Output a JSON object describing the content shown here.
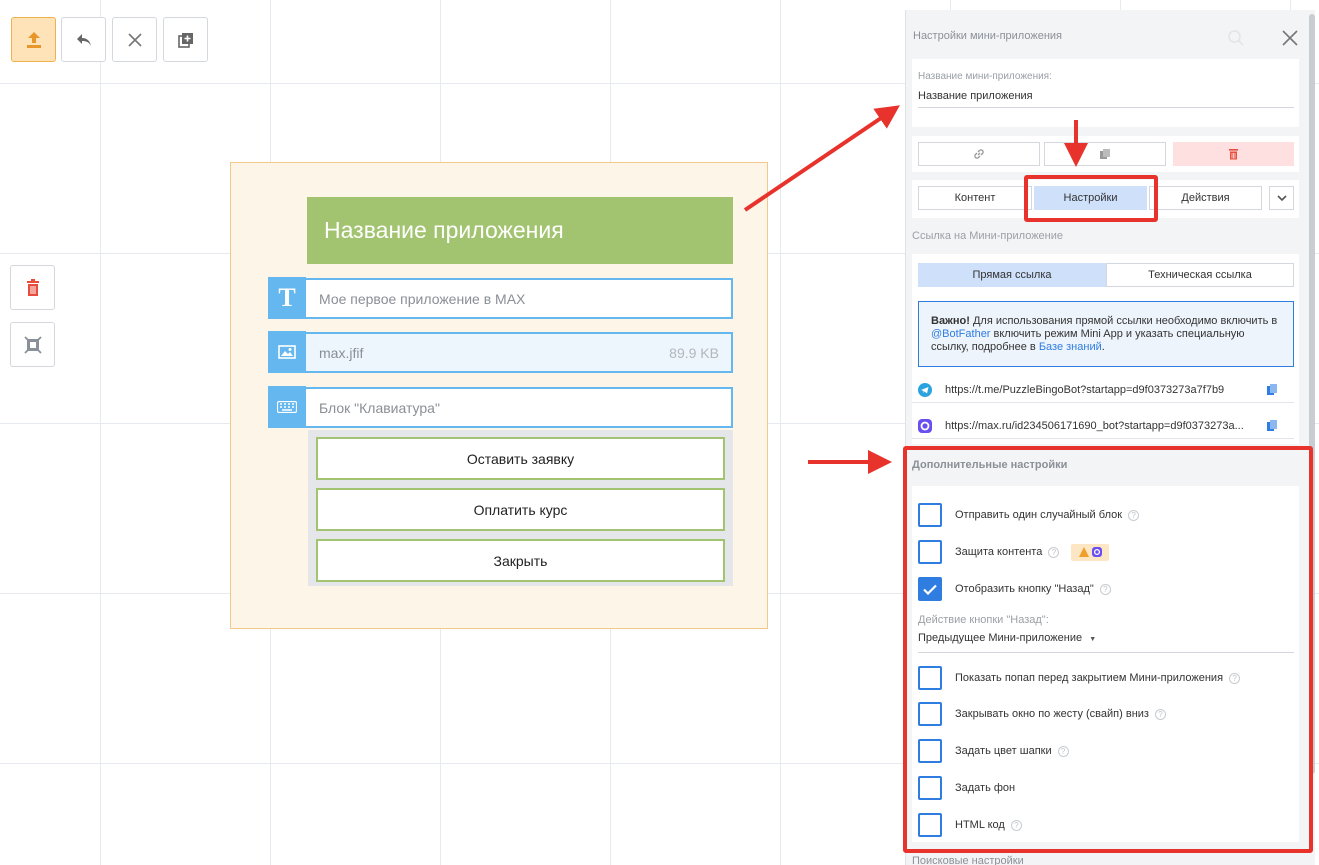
{
  "toolbar": {
    "upload_icon": "upload-icon",
    "undo_icon": "undo-icon",
    "close_icon": "close-icon",
    "add_icon": "add-copy-icon"
  },
  "side_tools": {
    "delete_icon": "trash-icon",
    "fit_icon": "fit-frame-icon"
  },
  "app_preview": {
    "title": "Название приложения",
    "text_block": "Мое первое приложение в MAX",
    "image_block": "max.jfif",
    "image_size": "89.9 KB",
    "keyboard_block": "Блок \"Клавиатура\"",
    "buttons": [
      "Оставить заявку",
      "Оплатить курс",
      "Закрыть"
    ]
  },
  "panel": {
    "title": "Настройки мини-приложения",
    "name_label": "Название мини-приложения:",
    "name_value": "Название приложения",
    "tabs": [
      "Контент",
      "Настройки",
      "Действия"
    ],
    "active_tab": "Настройки",
    "link_section_title": "Ссылка на Мини-приложение",
    "link_tabs": [
      "Прямая ссылка",
      "Техническая ссылка"
    ],
    "notice_bold": "Важно!",
    "notice_text_1": " Для использования прямой ссылки необходимо включить в ",
    "notice_link_1": "@BotFather",
    "notice_text_2": " включить режим Mini App и указать специальную ссылку, подробнее в ",
    "notice_link_2": "Базе знаний",
    "notice_text_3": ".",
    "link_telegram": "https://t.me/PuzzleBingoBot?startapp=d9f0373273a7f7b9",
    "link_max": "https://max.ru/id234506171690_bot?startapp=d9f0373273a...",
    "extra_title": "Дополнительные настройки",
    "options": [
      {
        "label": "Отправить один случайный блок",
        "checked": false
      },
      {
        "label": "Защита контента",
        "checked": false
      },
      {
        "label": "Отобразить кнопку \"Назад\"",
        "checked": true
      },
      {
        "label": "Показать попап перед закрытием Мини-приложения",
        "checked": false
      },
      {
        "label": "Закрывать окно по жесту (свайп) вниз",
        "checked": false
      },
      {
        "label": "Задать цвет шапки",
        "checked": false
      },
      {
        "label": "Задать фон",
        "checked": false
      },
      {
        "label": "HTML код",
        "checked": false
      }
    ],
    "back_action_label": "Действие кнопки \"Назад\":",
    "back_action_value": "Предыдущее Мини-приложение",
    "search_title": "Поисковые настройки"
  },
  "colors": {
    "accent": "#2f7de1",
    "annotation_red": "#e8322c",
    "app_header": "#a2c36f",
    "block_blue": "#64b8ef"
  }
}
